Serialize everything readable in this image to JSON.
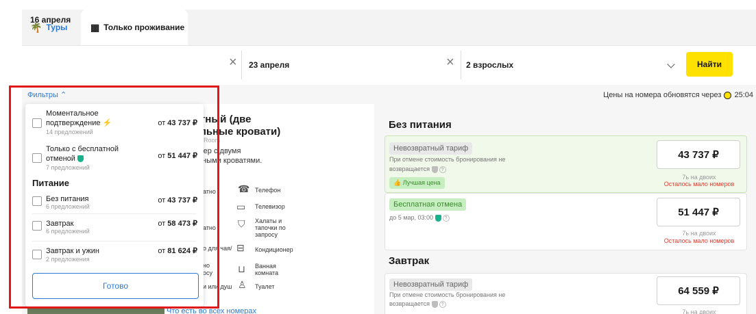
{
  "tabs": {
    "tours": "Туры",
    "stay_only": "Только проживание"
  },
  "search": {
    "checkin": "16 апреля",
    "checkout": "23 апреля",
    "guests": "2 взрослых",
    "find_label": "Найти"
  },
  "filters_link": "Фильтры",
  "price_update": {
    "text": "Цены на номера обновятся через",
    "timer": "25:04"
  },
  "room": {
    "title_line1": "ртный (две",
    "title_line2": "альные кровати)",
    "subtitle": "vin Room",
    "desc_line1": "омер с двумя",
    "desc_line2": "льными кроватями.",
    "amenities": {
      "phone": "Телефон",
      "tv": "Телевизор",
      "robes": "Халаты и тапочки по запросу",
      "ac": "Кондиционер",
      "bathroom": "Ванная комната",
      "toilet": "Туалет"
    },
    "frag_1": "атно",
    "frag_2": "атно",
    "frag_3": "о для чая/",
    "frag_4": "но",
    "frag_5": "осу",
    "frag_6": "и или душ",
    "all_rooms_link": "Что есть во всех номерах"
  },
  "right": {
    "no_meals_title": "Без питания",
    "breakfast_title": "Завтрак",
    "tariffs": [
      {
        "badge": "Невозвратный тариф",
        "note1": "При отмене стоимость бронирования не",
        "note2": "возвращается",
        "extra_badge": "Лучшая цена",
        "price": "43 737 ₽",
        "per": "7ь на двоих",
        "low": "Осталось мало номеров"
      },
      {
        "badge": "Бесплатная отмена",
        "note1": "до 5 мар, 03:00",
        "price": "51 447 ₽",
        "per": "7ь на двоих",
        "low": "Осталось мало номеров"
      },
      {
        "badge": "Невозвратный тариф",
        "note1": "При отмене стоимость бронирования не",
        "note2": "возвращается",
        "price": "64 559 ₽",
        "per": "7ь на двоих"
      }
    ]
  },
  "popup": {
    "items": [
      {
        "label1": "Моментальное",
        "label2": "подтверждение",
        "count": "14 предложений",
        "price_prefix": "от",
        "price": "43 737 ₽"
      },
      {
        "label1": "Только с бесплатной",
        "label2": "отменой",
        "count": "7 предложений",
        "price_prefix": "от",
        "price": "51 447 ₽"
      },
      {
        "label1": "Без питания",
        "count": "6 предложений",
        "price_prefix": "от",
        "price": "43 737 ₽"
      },
      {
        "label1": "Завтрак",
        "count": "6 предложений",
        "price_prefix": "от",
        "price": "58 473 ₽"
      },
      {
        "label1": "Завтрак и ужин",
        "count": "2 предложения",
        "price_prefix": "от",
        "price": "81 624 ₽"
      }
    ],
    "section_title": "Питание",
    "done_label": "Готово"
  },
  "colors": {
    "accent_blue": "#2a7bd6",
    "button_yellow": "#ffe100",
    "low_red": "#e23b2e",
    "frame_red": "#e01818"
  }
}
